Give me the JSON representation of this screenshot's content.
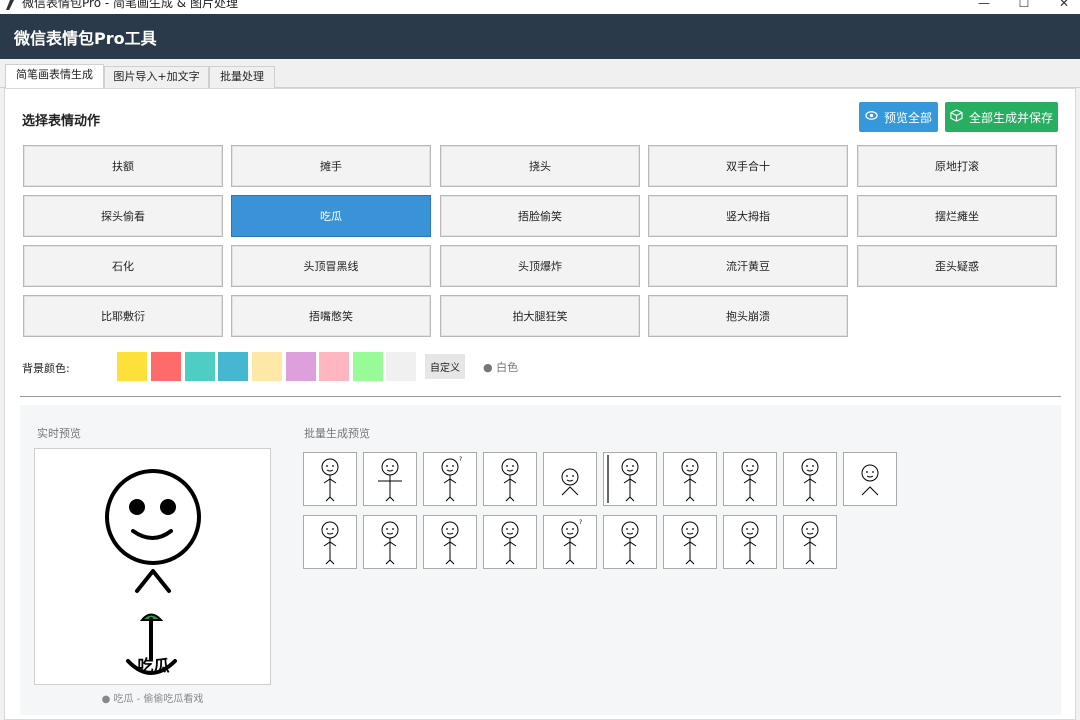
{
  "window": {
    "title": "微信表情包Pro - 简笔画生成 & 图片处理",
    "minimize_glyph": "—",
    "maximize_glyph": "☐",
    "close_glyph": "✕"
  },
  "app": {
    "title": "微信表情包Pro工具"
  },
  "tabs": [
    {
      "label": "简笔画表情生成",
      "active": true
    },
    {
      "label": "图片导入+加文字",
      "active": false
    },
    {
      "label": "批量处理",
      "active": false
    }
  ],
  "section": {
    "title": "选择表情动作"
  },
  "toolbar": {
    "preview_all_label": "预览全部",
    "preview_icon": "eye-icon",
    "save_all_label": "全部生成并保存",
    "save_icon": "box-icon",
    "preview_color": "#3498db",
    "save_color": "#27ae60"
  },
  "actions": [
    {
      "label": "扶额"
    },
    {
      "label": "摊手"
    },
    {
      "label": "挠头"
    },
    {
      "label": "双手合十"
    },
    {
      "label": "原地打滚"
    },
    {
      "label": "探头偷看"
    },
    {
      "label": "吃瓜",
      "selected": true
    },
    {
      "label": "捂脸偷笑"
    },
    {
      "label": "竖大拇指"
    },
    {
      "label": "摆烂瘫坐"
    },
    {
      "label": "石化"
    },
    {
      "label": "头顶冒黑线"
    },
    {
      "label": "头顶爆炸"
    },
    {
      "label": "流汗黄豆"
    },
    {
      "label": "歪头疑惑"
    },
    {
      "label": "比耶敷衍"
    },
    {
      "label": "捂嘴憋笑"
    },
    {
      "label": "拍大腿狂笑"
    },
    {
      "label": "抱头崩溃"
    }
  ],
  "background": {
    "label": "背景颜色:",
    "swatches": [
      "#fde13a",
      "#ff6b6b",
      "#4ecdc4",
      "#45b7d1",
      "#fde8a8",
      "#dda0dd",
      "#ffb6c1",
      "#98fb98",
      "#f0f0f0"
    ],
    "custom_label": "自定义",
    "current_label": "● 白色"
  },
  "preview": {
    "live_label": "实时预览",
    "batch_label": "批量生成预览",
    "live_text": "吃瓜",
    "caption": "● 吃瓜 - 偷偷吃瓜看戏",
    "accent_color": "#2e9e3e"
  },
  "batch_thumbs": [
    {
      "face": "smirk",
      "pose": "stand"
    },
    {
      "face": "squint",
      "pose": "tpose"
    },
    {
      "face": "question",
      "pose": "stand"
    },
    {
      "face": "ooo",
      "pose": "label"
    },
    {
      "face": "drool",
      "pose": "sit"
    },
    {
      "face": "peek",
      "pose": "peek"
    },
    {
      "face": "bigeyes",
      "pose": "melon"
    },
    {
      "face": "blank",
      "pose": "cover"
    },
    {
      "face": "wink",
      "pose": "thumb"
    },
    {
      "face": "flat",
      "pose": "slump"
    },
    {
      "face": "shock",
      "pose": "stand"
    },
    {
      "face": "angry",
      "pose": "label"
    },
    {
      "face": "angry2",
      "pose": "label"
    },
    {
      "face": "sweat",
      "pose": "label"
    },
    {
      "face": "question2",
      "pose": "label"
    },
    {
      "face": "smile",
      "pose": "label"
    },
    {
      "face": "laugh",
      "pose": "label"
    },
    {
      "face": "smile2",
      "pose": "hug"
    },
    {
      "face": "cross",
      "pose": "hug2"
    }
  ]
}
